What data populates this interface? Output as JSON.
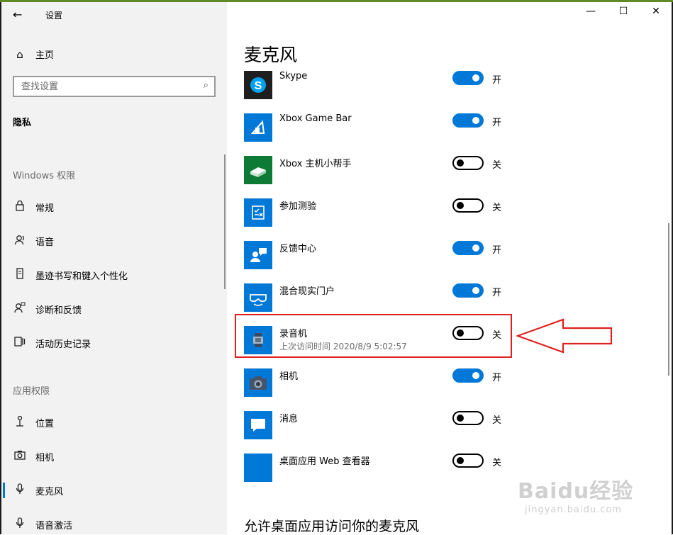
{
  "window": {
    "title": "设置",
    "controls": {
      "minimize": "—",
      "maximize": "☐",
      "close": "✕"
    }
  },
  "sidebar": {
    "back_icon": "←",
    "home": {
      "icon": "⌂",
      "label": "主页"
    },
    "search": {
      "placeholder": "查找设置",
      "icon": "⌕"
    },
    "current_section": "隐私",
    "groups": [
      {
        "label": "Windows 权限",
        "items": [
          {
            "icon": "lock-icon",
            "glyph": "🔒︎",
            "label": "常规"
          },
          {
            "icon": "speech-icon",
            "glyph": "☺",
            "label": "语音"
          },
          {
            "icon": "ink-icon",
            "glyph": "▯",
            "label": "墨迹书写和键入个性化"
          },
          {
            "icon": "feedback-icon",
            "glyph": "☺",
            "label": "诊断和反馈"
          },
          {
            "icon": "activity-icon",
            "glyph": "☰",
            "label": "活动历史记录"
          }
        ]
      },
      {
        "label": "应用权限",
        "items": [
          {
            "icon": "location-icon",
            "glyph": "⚲",
            "label": "位置"
          },
          {
            "icon": "camera-icon",
            "glyph": "◘",
            "label": "相机"
          },
          {
            "icon": "microphone-icon",
            "glyph": "🎙︎",
            "label": "麦克风",
            "active": true
          },
          {
            "icon": "voice-activation-icon",
            "glyph": "🎙︎",
            "label": "语音激活"
          }
        ]
      }
    ]
  },
  "main": {
    "title": "麦克风",
    "apps": [
      {
        "name": "Skype",
        "icon": "skype-icon",
        "on": true,
        "state": "开"
      },
      {
        "name": "Xbox Game Bar",
        "icon": "xbox-game-bar-icon",
        "on": true,
        "state": "开"
      },
      {
        "name": "Xbox 主机小帮手",
        "icon": "xbox-console-icon",
        "on": false,
        "state": "关"
      },
      {
        "name": "参加测验",
        "icon": "test-icon",
        "on": false,
        "state": "关"
      },
      {
        "name": "反馈中心",
        "icon": "feedback-hub-icon",
        "on": true,
        "state": "开"
      },
      {
        "name": "混合现实门户",
        "icon": "mixed-reality-icon",
        "on": true,
        "state": "开"
      },
      {
        "name": "录音机",
        "icon": "voice-recorder-icon",
        "on": false,
        "state": "关",
        "last_access": "上次访问时间 2020/8/9 5:02:57"
      },
      {
        "name": "相机",
        "icon": "camera-app-icon",
        "on": true,
        "state": "开"
      },
      {
        "name": "消息",
        "icon": "messaging-icon",
        "on": false,
        "state": "关"
      },
      {
        "name": "桌面应用 Web 查看器",
        "icon": "web-viewer-icon",
        "on": false,
        "state": "关"
      }
    ],
    "footer_heading": "允许桌面应用访问你的麦克风"
  },
  "colors": {
    "accent": "#0078d7",
    "highlight": "#e02020"
  },
  "watermark": {
    "logo": "Baidu经验",
    "url": "jingyan.baidu.com"
  }
}
